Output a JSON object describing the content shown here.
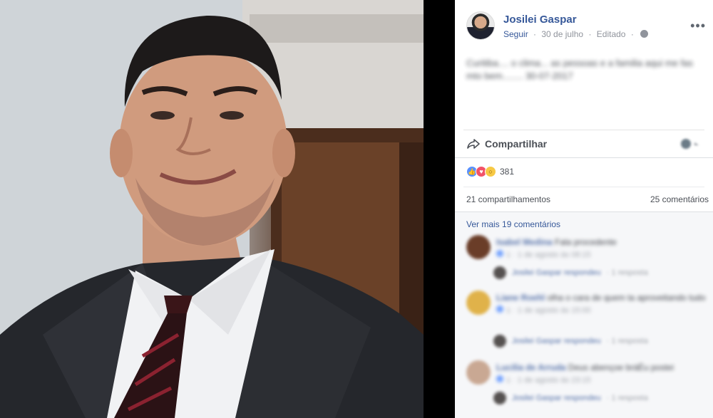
{
  "post": {
    "author": "Josilei Gaspar",
    "follow_label": "Seguir",
    "date": "30 de julho",
    "edited_label": "Editado",
    "text": "Curitiba.... o clima... as pessoas e a familia aqui me fas mto bem........ 30-07-2017",
    "more_label": "•••"
  },
  "actions": {
    "share_label": "Compartilhar"
  },
  "stats": {
    "reaction_count": "381",
    "shares": "21 compartilhamentos",
    "comments": "25 comentários"
  },
  "comments": {
    "view_more": "Ver mais 19 comentários",
    "items": [
      {
        "name": "Isabel Medina",
        "text": "Fala procedente",
        "meta": "1 · 1 de agosto às 08:15",
        "reply": "Josilei Gaspar respondeu",
        "reply_meta": "· 1 resposta"
      },
      {
        "name": "Liane Roehl",
        "text": "olha o cara de quem ta aproveitando tudo",
        "meta": "1 · 1 de agosto às 15:00",
        "reply": "Josilei Gaspar respondeu",
        "reply_meta": "· 1 resposta"
      },
      {
        "name": "Lucilia de Arruda",
        "text": "Deus abençoe bráÉu postei",
        "meta": "1 · 1 de agosto às 23:15",
        "reply": "Josilei Gaspar respondeu",
        "reply_meta": "· 1 resposta"
      }
    ]
  },
  "colors": {
    "link_blue": "#365899",
    "like_blue": "#5890ff",
    "love_red": "#f25268",
    "wow_yellow": "#f7c945"
  },
  "icons": [
    "globe-icon",
    "more-icon",
    "share-icon",
    "like-icon",
    "love-icon",
    "wow-icon"
  ]
}
